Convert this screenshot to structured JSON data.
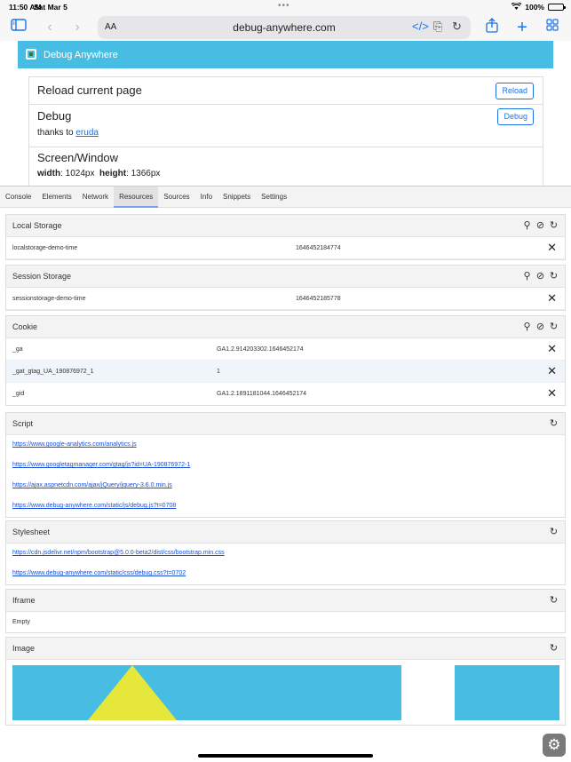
{
  "status": {
    "time": "11:50 AM",
    "date": "Sat Mar 5",
    "battery": "100%"
  },
  "toolbar": {
    "text_size_label": "AA",
    "url": "debug-anywhere.com"
  },
  "page": {
    "banner_title": "Debug Anywhere",
    "reload_card": {
      "title": "Reload current page",
      "button": "Reload"
    },
    "debug_card": {
      "title": "Debug",
      "thanks_prefix": "thanks to",
      "thanks_link": "eruda",
      "button": "Debug"
    },
    "screen_card": {
      "title": "Screen/Window",
      "width_label": "width",
      "width_value": ": 1024px",
      "height_label": "height",
      "height_value": ": 1366px"
    }
  },
  "eruda": {
    "tabs": [
      "Console",
      "Elements",
      "Network",
      "Resources",
      "Sources",
      "Info",
      "Snippets",
      "Settings"
    ],
    "active_tab": "Resources",
    "local_storage": {
      "title": "Local Storage",
      "rows": [
        {
          "key": "localstorage-demo-time",
          "value": "1646452184774"
        }
      ]
    },
    "session_storage": {
      "title": "Session Storage",
      "rows": [
        {
          "key": "sessionstorage-demo-time",
          "value": "1646452185778"
        }
      ]
    },
    "cookie": {
      "title": "Cookie",
      "rows": [
        {
          "key": "_ga",
          "value": "GA1.2.914203302.1646452174"
        },
        {
          "key": "_gat_gtag_UA_190876972_1",
          "value": "1"
        },
        {
          "key": "_gid",
          "value": "GA1.2.1891181044.1646452174"
        }
      ]
    },
    "script": {
      "title": "Script",
      "links": [
        "https://www.google-analytics.com/analytics.js",
        "https://www.googletagmanager.com/gtag/js?id=UA-190876972-1",
        "https://ajax.aspnetcdn.com/ajax/jQuery/jquery-3.6.0.min.js",
        "https://www.debug-anywhere.com/static/js/debug.js?t=0708"
      ]
    },
    "stylesheet": {
      "title": "Stylesheet",
      "links": [
        "https://cdn.jsdelivr.net/npm/bootstrap@5.0.0-beta2/dist/css/bootstrap.min.css",
        "https://www.debug-anywhere.com/static/css/debug.css?t=0702"
      ]
    },
    "iframe": {
      "title": "Iframe",
      "empty": "Empty"
    },
    "image": {
      "title": "Image"
    }
  },
  "colors": {
    "banner": "#48bde3",
    "accent": "#1a73e8",
    "image_yellow": "#e5e83a"
  }
}
